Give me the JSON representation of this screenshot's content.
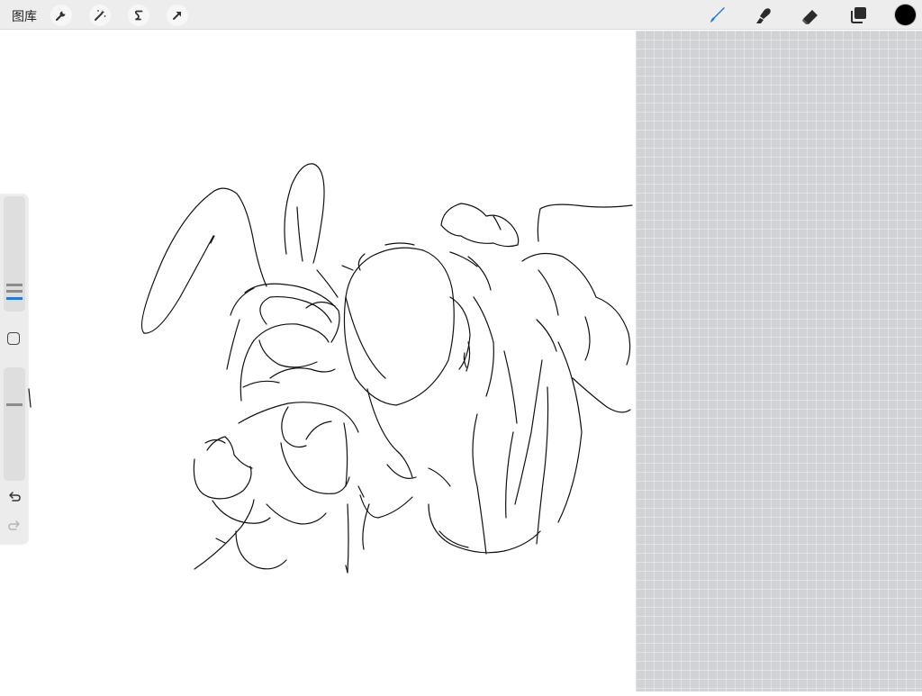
{
  "toolbar": {
    "gallery_label": "图库",
    "left_tools": [
      {
        "name": "adjustments",
        "icon": "wrench-icon"
      },
      {
        "name": "adjustments-magic",
        "icon": "magic-wand-icon"
      },
      {
        "name": "selection",
        "icon": "selection-s-icon"
      },
      {
        "name": "transform",
        "icon": "arrow-cursor-icon"
      }
    ],
    "right_tools": [
      {
        "name": "brush",
        "icon": "brush-icon",
        "active": true
      },
      {
        "name": "smudge",
        "icon": "smudge-icon",
        "active": false
      },
      {
        "name": "eraser",
        "icon": "eraser-icon",
        "active": false
      },
      {
        "name": "layers",
        "icon": "layers-icon",
        "active": false
      }
    ],
    "current_color": "#000000",
    "accent_color": "#1f7ae0"
  },
  "sidebar": {
    "size_slider": "brush-size-slider",
    "opacity_slider": "opacity-slider",
    "modify_button": "square-icon",
    "undo": "undo-icon",
    "redo": "redo-icon"
  },
  "canvas": {
    "background": "#ffffff",
    "outside_area": "#d1d2d5",
    "content": "line sketch"
  }
}
